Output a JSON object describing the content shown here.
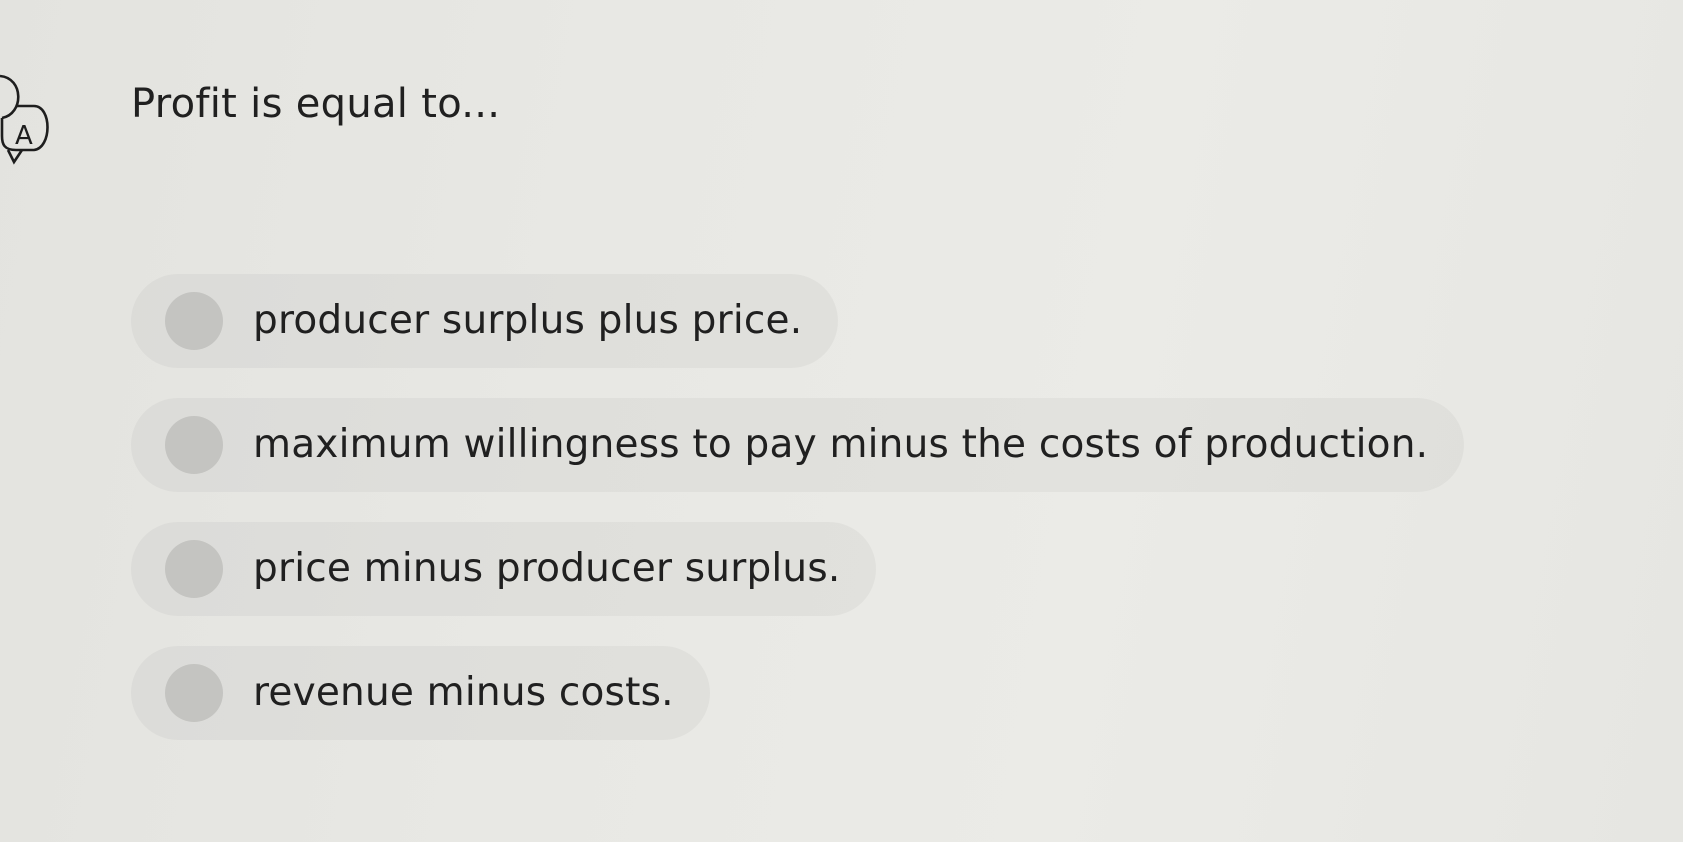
{
  "translate_icon": {
    "glyph": "A",
    "icon": "translate-icon"
  },
  "question": {
    "text": "Profit is equal to..."
  },
  "options": [
    {
      "label": "producer surplus plus price."
    },
    {
      "label": "maximum willingness to pay minus the costs of production."
    },
    {
      "label": "price minus producer surplus."
    },
    {
      "label": "revenue minus costs."
    }
  ]
}
